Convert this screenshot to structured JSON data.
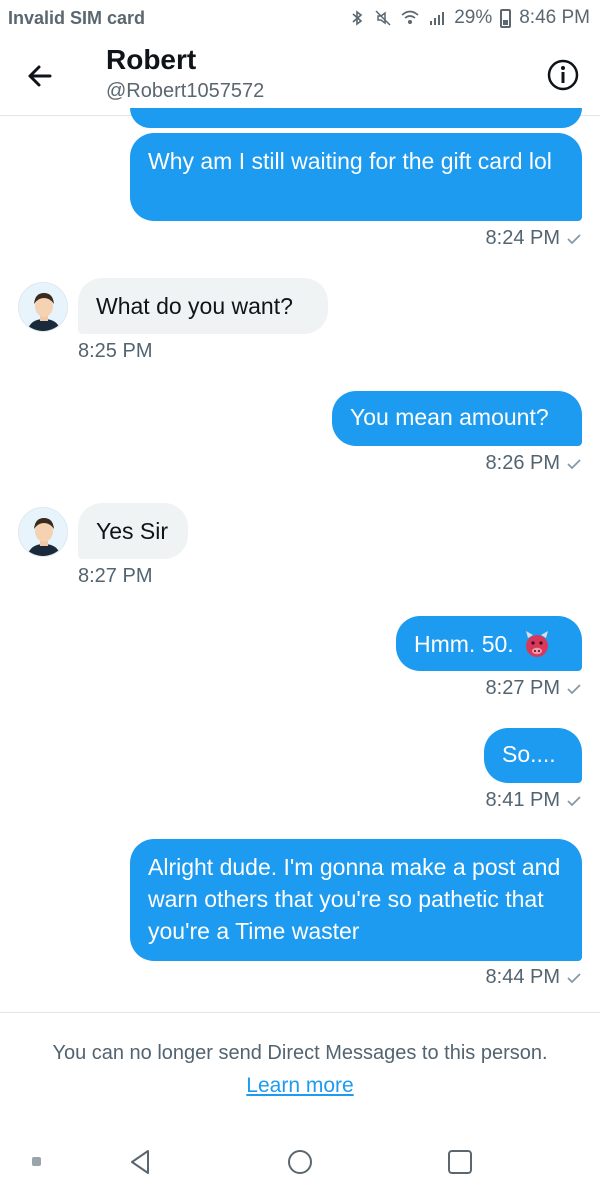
{
  "status_bar": {
    "carrier": "Invalid SIM card",
    "battery": "29%",
    "time": "8:46 PM"
  },
  "header": {
    "name": "Robert",
    "handle": "@Robert1057572"
  },
  "messages": [
    {
      "direction": "out",
      "text": "Why am I still waiting for the gift card lol",
      "time": "8:24 PM"
    },
    {
      "direction": "in",
      "text": "What do you want?",
      "time": "8:25 PM"
    },
    {
      "direction": "out",
      "text": "You mean amount?",
      "time": "8:26 PM"
    },
    {
      "direction": "in",
      "text": "Yes Sir",
      "time": "8:27 PM"
    },
    {
      "direction": "out",
      "text": "Hmm. 50.",
      "emoji": "🐮",
      "time": "8:27 PM"
    },
    {
      "direction": "out",
      "text": "So....",
      "time": "8:41 PM"
    },
    {
      "direction": "out",
      "text": "Alright dude. I'm gonna make a post and warn others that you're so pathetic that you're a Time waster",
      "time": "8:44 PM"
    }
  ],
  "footer": {
    "notice": "You can no longer send Direct Messages to this person.",
    "link": "Learn more"
  },
  "colors": {
    "accent": "#1d9bf0",
    "incoming_bubble": "#eff3f4"
  }
}
